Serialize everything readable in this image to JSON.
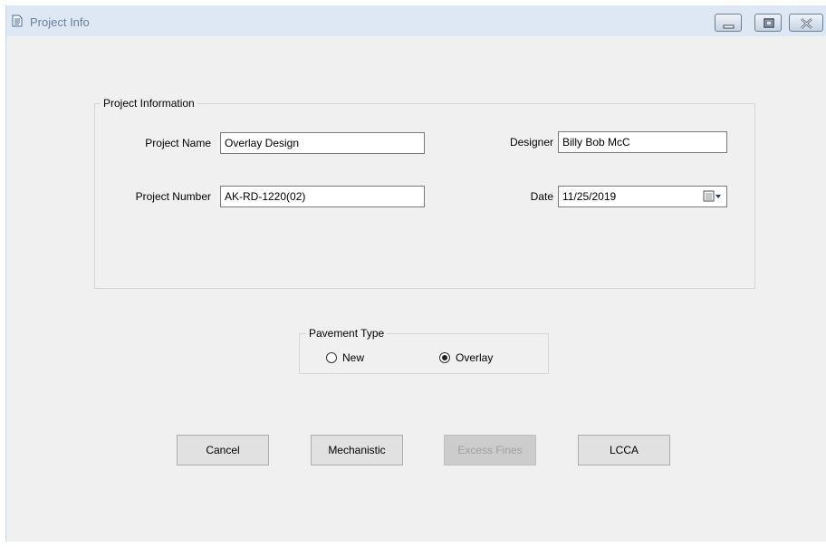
{
  "window": {
    "title": "Project Info",
    "controls": {
      "minimize": "minimize-icon",
      "restore": "restore-icon",
      "close": "close-icon"
    }
  },
  "project_info": {
    "legend": "Project Information",
    "project_name_label": "Project Name",
    "project_name_value": "Overlay Design",
    "project_number_label": "Project Number",
    "project_number_value": "AK-RD-1220(02)",
    "designer_label": "Designer",
    "designer_value": "Billy Bob McC",
    "date_label": "Date",
    "date_value": "11/25/2019"
  },
  "pavement_type": {
    "legend": "Pavement Type",
    "options": [
      {
        "label": "New",
        "selected": false
      },
      {
        "label": "Overlay",
        "selected": true
      }
    ]
  },
  "buttons": {
    "cancel": "Cancel",
    "mechanistic": "Mechanistic",
    "excess_fines": "Excess Fines",
    "lcca": "LCCA"
  },
  "colors": {
    "titlebar": "#dde8f4",
    "window_bg": "#f0f0f0",
    "disabled_text": "#a0a0a0"
  }
}
